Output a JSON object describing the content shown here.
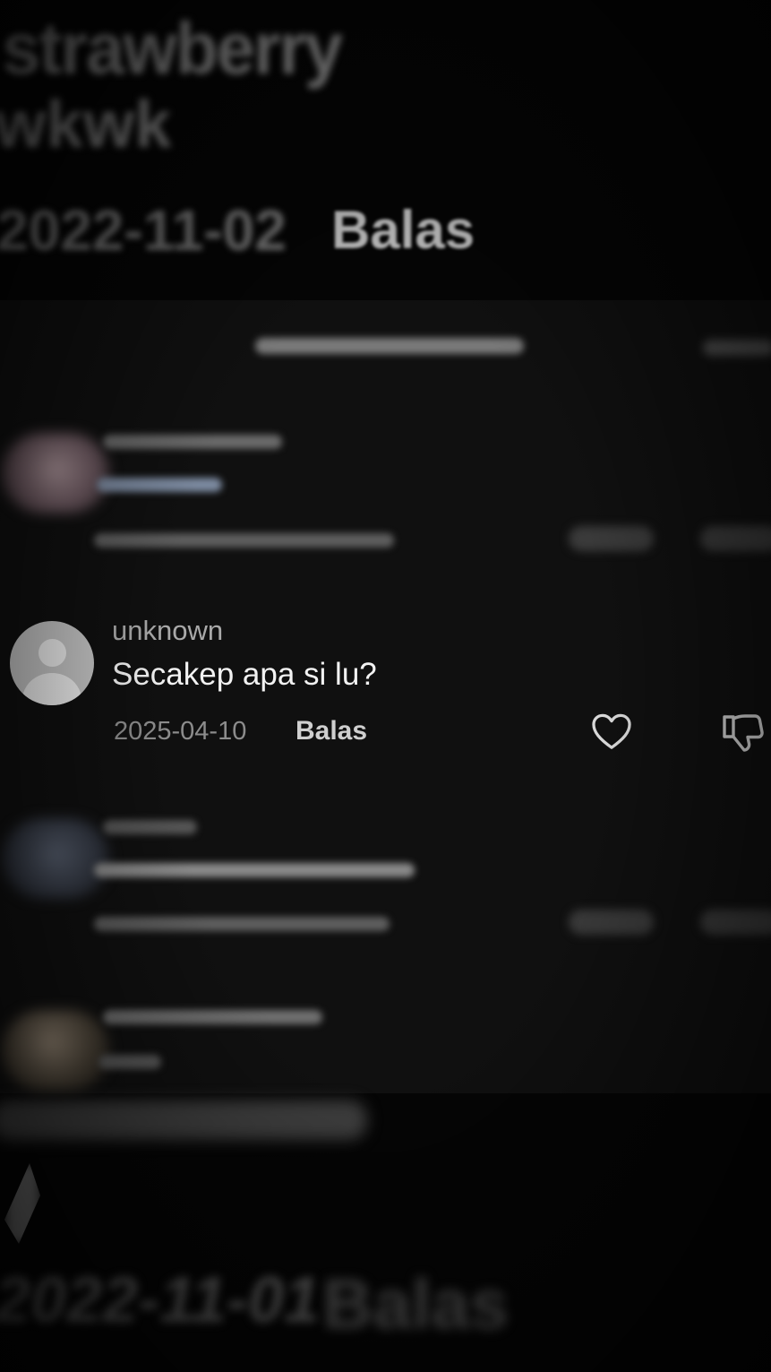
{
  "top_blurred": {
    "username": "strawberry",
    "comment": "wkwk",
    "date": "2022-11-02",
    "reply_label": "Balas"
  },
  "focused_comment": {
    "username": "unknown",
    "message": "Secakep apa si lu?",
    "date": "2025-04-10",
    "reply_label": "Balas",
    "avatar_icon": "default-avatar-icon",
    "like_icon": "heart-outline-icon",
    "dislike_icon": "thumbs-down-icon"
  },
  "bottom_blurred": {
    "date": "2022-11-01",
    "reply_label": "Balas"
  },
  "colors": {
    "background": "#050505",
    "panel": "#101010",
    "username": "#a9a9a9",
    "message": "#f2f2f2",
    "date": "#8c8c8c"
  }
}
